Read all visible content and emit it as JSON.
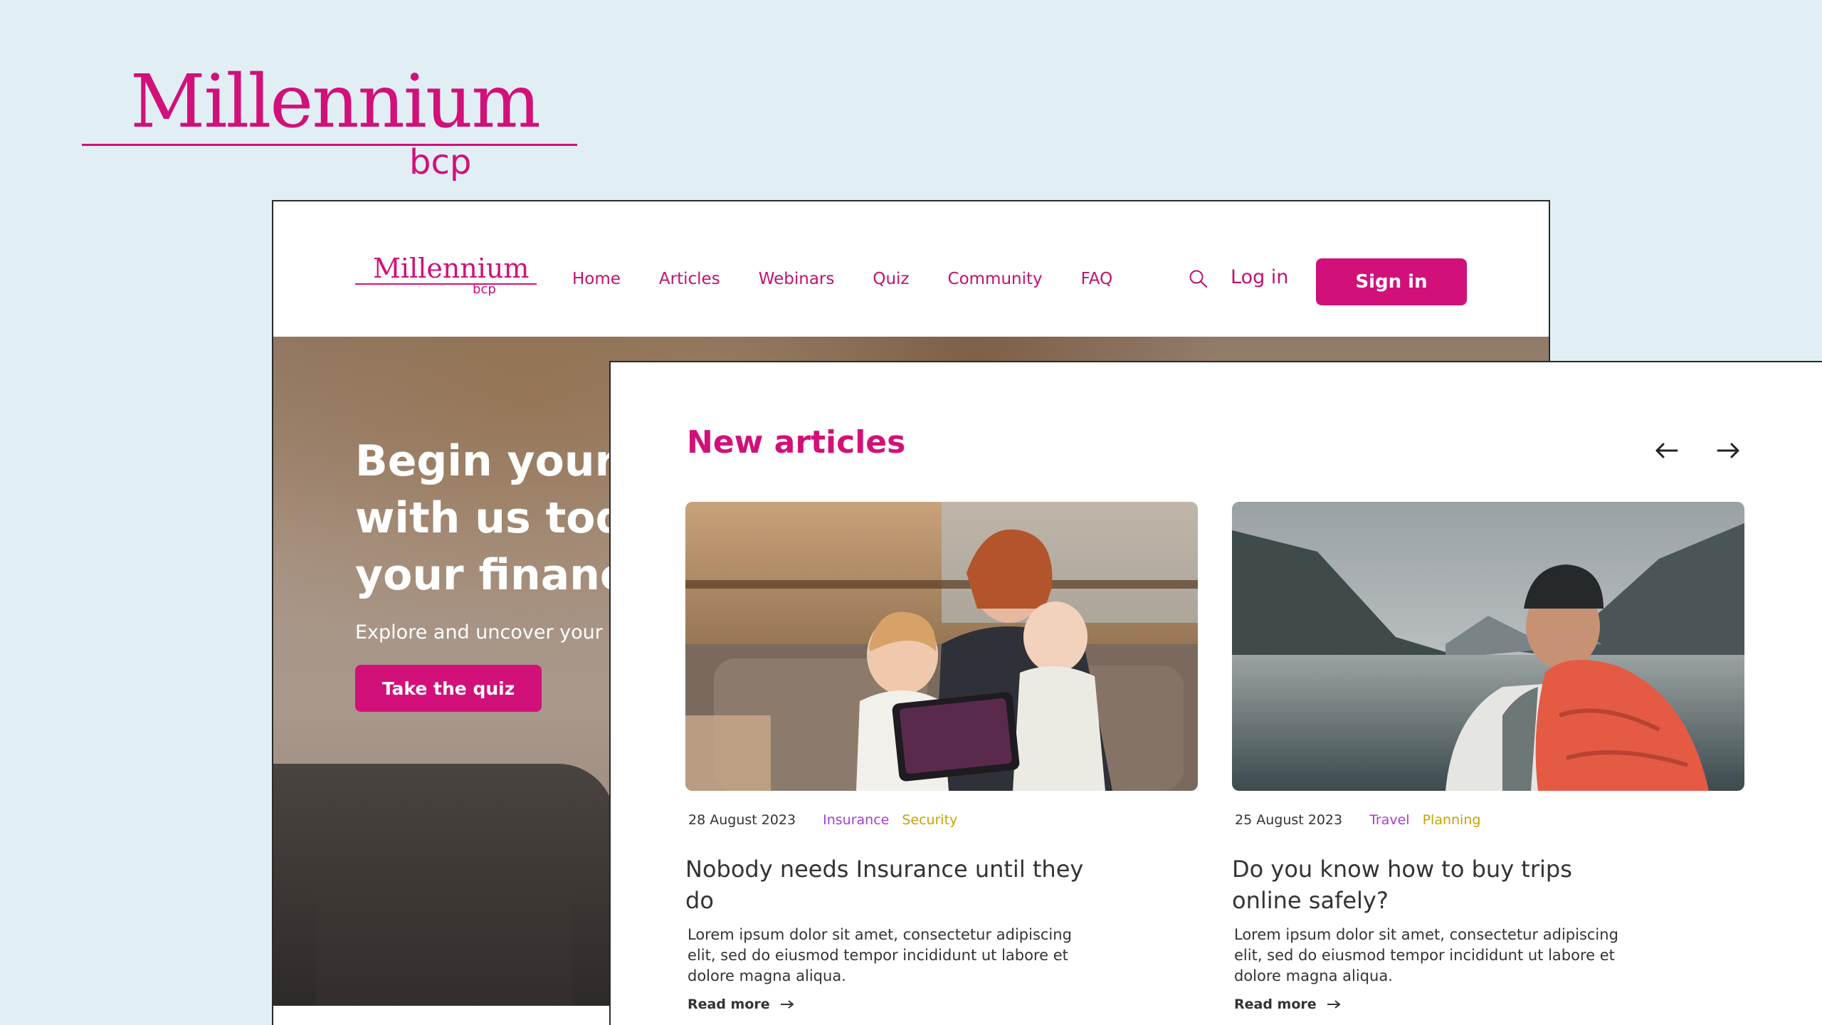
{
  "brand": {
    "name": "Millennium",
    "sub": "bcp",
    "accent_color": "#d1107a"
  },
  "nav": {
    "logo_name": "Millennium",
    "logo_sub": "bcp",
    "links": [
      "Home",
      "Articles",
      "Webinars",
      "Quiz",
      "Community",
      "FAQ"
    ],
    "search_icon": "search-icon",
    "login_label": "Log in",
    "signin_label": "Sign in"
  },
  "hero": {
    "title_line1": "Begin your i",
    "title_line2": "with us toda",
    "title_line3": "your financi",
    "subtitle": "Explore and uncover your ir",
    "cta_label": "Take the quiz"
  },
  "articles": {
    "title": "New articles",
    "prev_icon": "arrow-left-icon",
    "next_icon": "arrow-right-icon",
    "cards": [
      {
        "date": "28 August 2023",
        "tags": [
          "Insurance",
          "Security"
        ],
        "title": "Nobody needs Insurance until they do",
        "body": "Lorem ipsum dolor sit amet, consectetur adipiscing elit, sed do eiusmod tempor incididunt ut labore et dolore magna aliqua.",
        "read_more": "Read more"
      },
      {
        "date": "25 August 2023",
        "tags": [
          "Travel",
          "Planning"
        ],
        "title": "Do you know how to buy trips online safely?",
        "body": "Lorem ipsum dolor sit amet, consectetur adipiscing elit, sed do eiusmod tempor incididunt ut labore et dolore magna aliqua.",
        "read_more": "Read more"
      }
    ]
  }
}
